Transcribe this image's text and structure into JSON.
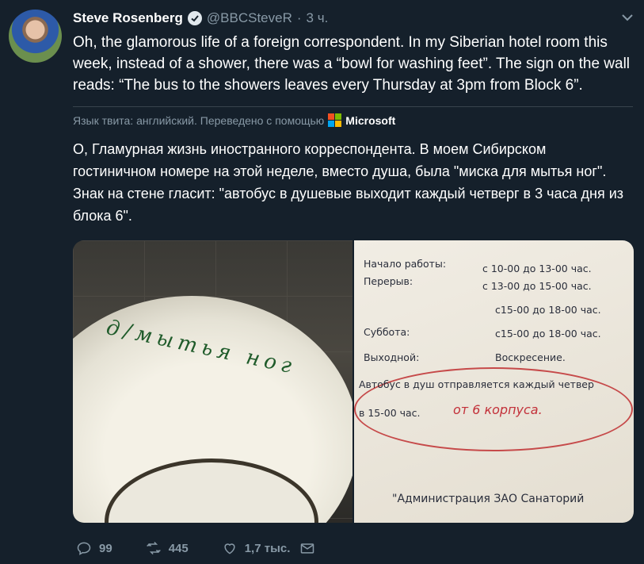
{
  "author": {
    "name": "Steve Rosenberg",
    "handle": "@BBCSteveR",
    "separator": "·",
    "time": "3 ч."
  },
  "tweet": {
    "text_en": "Oh, the glamorous life of a foreign correspondent. In my Siberian hotel room this week, instead of a shower, there was a “bowl for washing feet”. The sign on the wall reads: “The bus to the showers leaves every Thursday at 3pm from Block 6”.",
    "translation_label": "Язык твита: английский. Переведено с помощью",
    "translation_provider": "Microsoft",
    "text_ru": "О, Гламурная жизнь иностранного корреспондента. В моем Сибирском гостиничном номере на этой неделе, вместо душа, была \"миска для мытья ног\". Знак на стене гласит: \"автобус в душевые выходит каждый четверг в 3 часа дня из блока 6\"."
  },
  "media": {
    "bowl_text": "д/мытья ног",
    "sign": {
      "row1_label": "Начало работы:",
      "row1_value": "с 10-00 до 13-00 час.",
      "row2_label": "Перерыв:",
      "row2_value": "с 13-00 до 15-00 час.",
      "row3_value": "с15-00 до 18-00 час.",
      "row4_label": "Суббота:",
      "row4_value": "с15-00 до 18-00 час.",
      "row5_label": "Выходной:",
      "row5_value": "Воскресение.",
      "bus_line1": "Автобус в душ отправляется каждый четвер",
      "bus_line2": "в 15-00 час.",
      "handwritten": "от 6 корпуса.",
      "footer": "\"Администрация ЗАО Санаторий"
    }
  },
  "actions": {
    "replies": "99",
    "retweets": "445",
    "likes": "1,7 тыс."
  },
  "colors": {
    "background": "#15202b",
    "muted": "#8899a6",
    "text": "#ffffff"
  }
}
